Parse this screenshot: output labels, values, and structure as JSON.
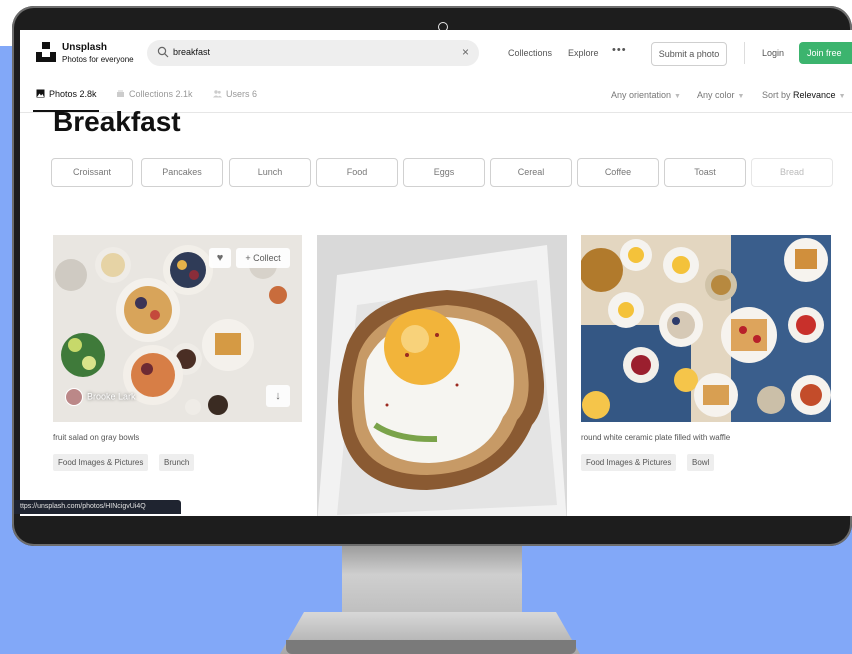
{
  "header": {
    "brand": "Unsplash",
    "tagline": "Photos for everyone",
    "search_value": "breakfast",
    "nav_collections": "Collections",
    "nav_explore": "Explore",
    "nav_more": "•••",
    "submit_label": "Submit a photo",
    "login_label": "Login",
    "join_label": "Join free"
  },
  "tabs": [
    {
      "label": "Photos 2.8k",
      "icon": "photo-icon"
    },
    {
      "label": "Collections 2.1k",
      "icon": "collections-icon"
    },
    {
      "label": "Users 6",
      "icon": "users-icon"
    }
  ],
  "filters": {
    "orientation": "Any orientation",
    "color": "Any color",
    "sort_prefix": "Sort by",
    "sort_value": "Relevance"
  },
  "page_title": "Breakfast",
  "related": [
    "Croissant",
    "Pancakes",
    "Lunch",
    "Food",
    "Eggs",
    "Cereal",
    "Coffee",
    "Toast",
    "Bread"
  ],
  "photos": [
    {
      "caption": "fruit salad on gray bowls",
      "author": "Brooke Lark",
      "tags": [
        "Food Images & Pictures",
        "Brunch"
      ],
      "collect_label": "+ Collect"
    },
    {
      "caption": "",
      "tags": []
    },
    {
      "caption": "round white ceramic plate filled with waffle",
      "tags": [
        "Food Images & Pictures",
        "Bowl"
      ]
    }
  ],
  "status_url": "ttps://unsplash.com/photos/HINcigvUi4Q",
  "colors": {
    "accent_green": "#3cb46e",
    "backdrop": "#82a8f8"
  }
}
